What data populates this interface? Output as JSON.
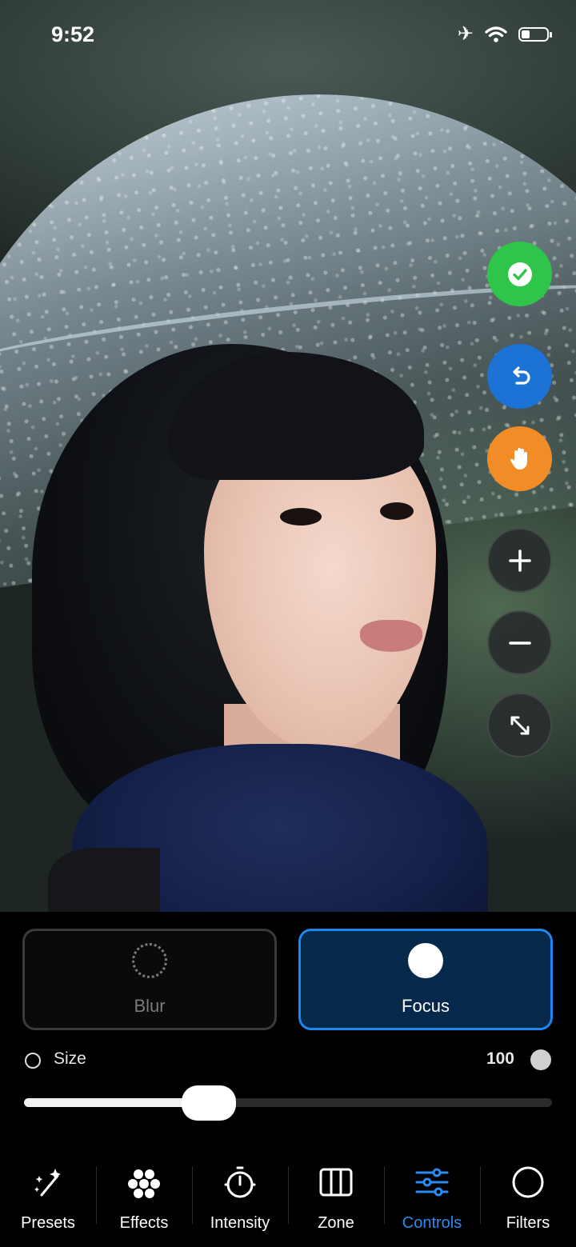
{
  "status_bar": {
    "time": "9:52",
    "icons": [
      "airplane-icon",
      "wifi-icon",
      "battery-icon"
    ]
  },
  "tools": [
    {
      "name": "confirm",
      "icon": "checkmark-icon",
      "color": "#2fc44a"
    },
    {
      "name": "undo",
      "icon": "undo-icon",
      "color": "#1d72d6"
    },
    {
      "name": "pan",
      "icon": "hand-icon",
      "color": "#f28c26"
    },
    {
      "name": "zoom-in",
      "icon": "plus-icon"
    },
    {
      "name": "zoom-out",
      "icon": "minus-icon"
    },
    {
      "name": "fit",
      "icon": "expand-icon"
    }
  ],
  "modes": {
    "blur_label": "Blur",
    "focus_label": "Focus",
    "selected": "Focus"
  },
  "size": {
    "label": "Size",
    "value": "100",
    "slider_fraction": 0.35
  },
  "tabs": [
    {
      "label": "Presets",
      "icon": "magic-wand-icon"
    },
    {
      "label": "Effects",
      "icon": "bokeh-icon"
    },
    {
      "label": "Intensity",
      "icon": "timer-dial-icon"
    },
    {
      "label": "Zone",
      "icon": "columns-icon"
    },
    {
      "label": "Controls",
      "icon": "sliders-icon",
      "active": true
    },
    {
      "label": "Filters",
      "icon": "circle-icon"
    }
  ],
  "colors": {
    "accent": "#2a8bf2",
    "focus_card_bg": "#06284a"
  }
}
